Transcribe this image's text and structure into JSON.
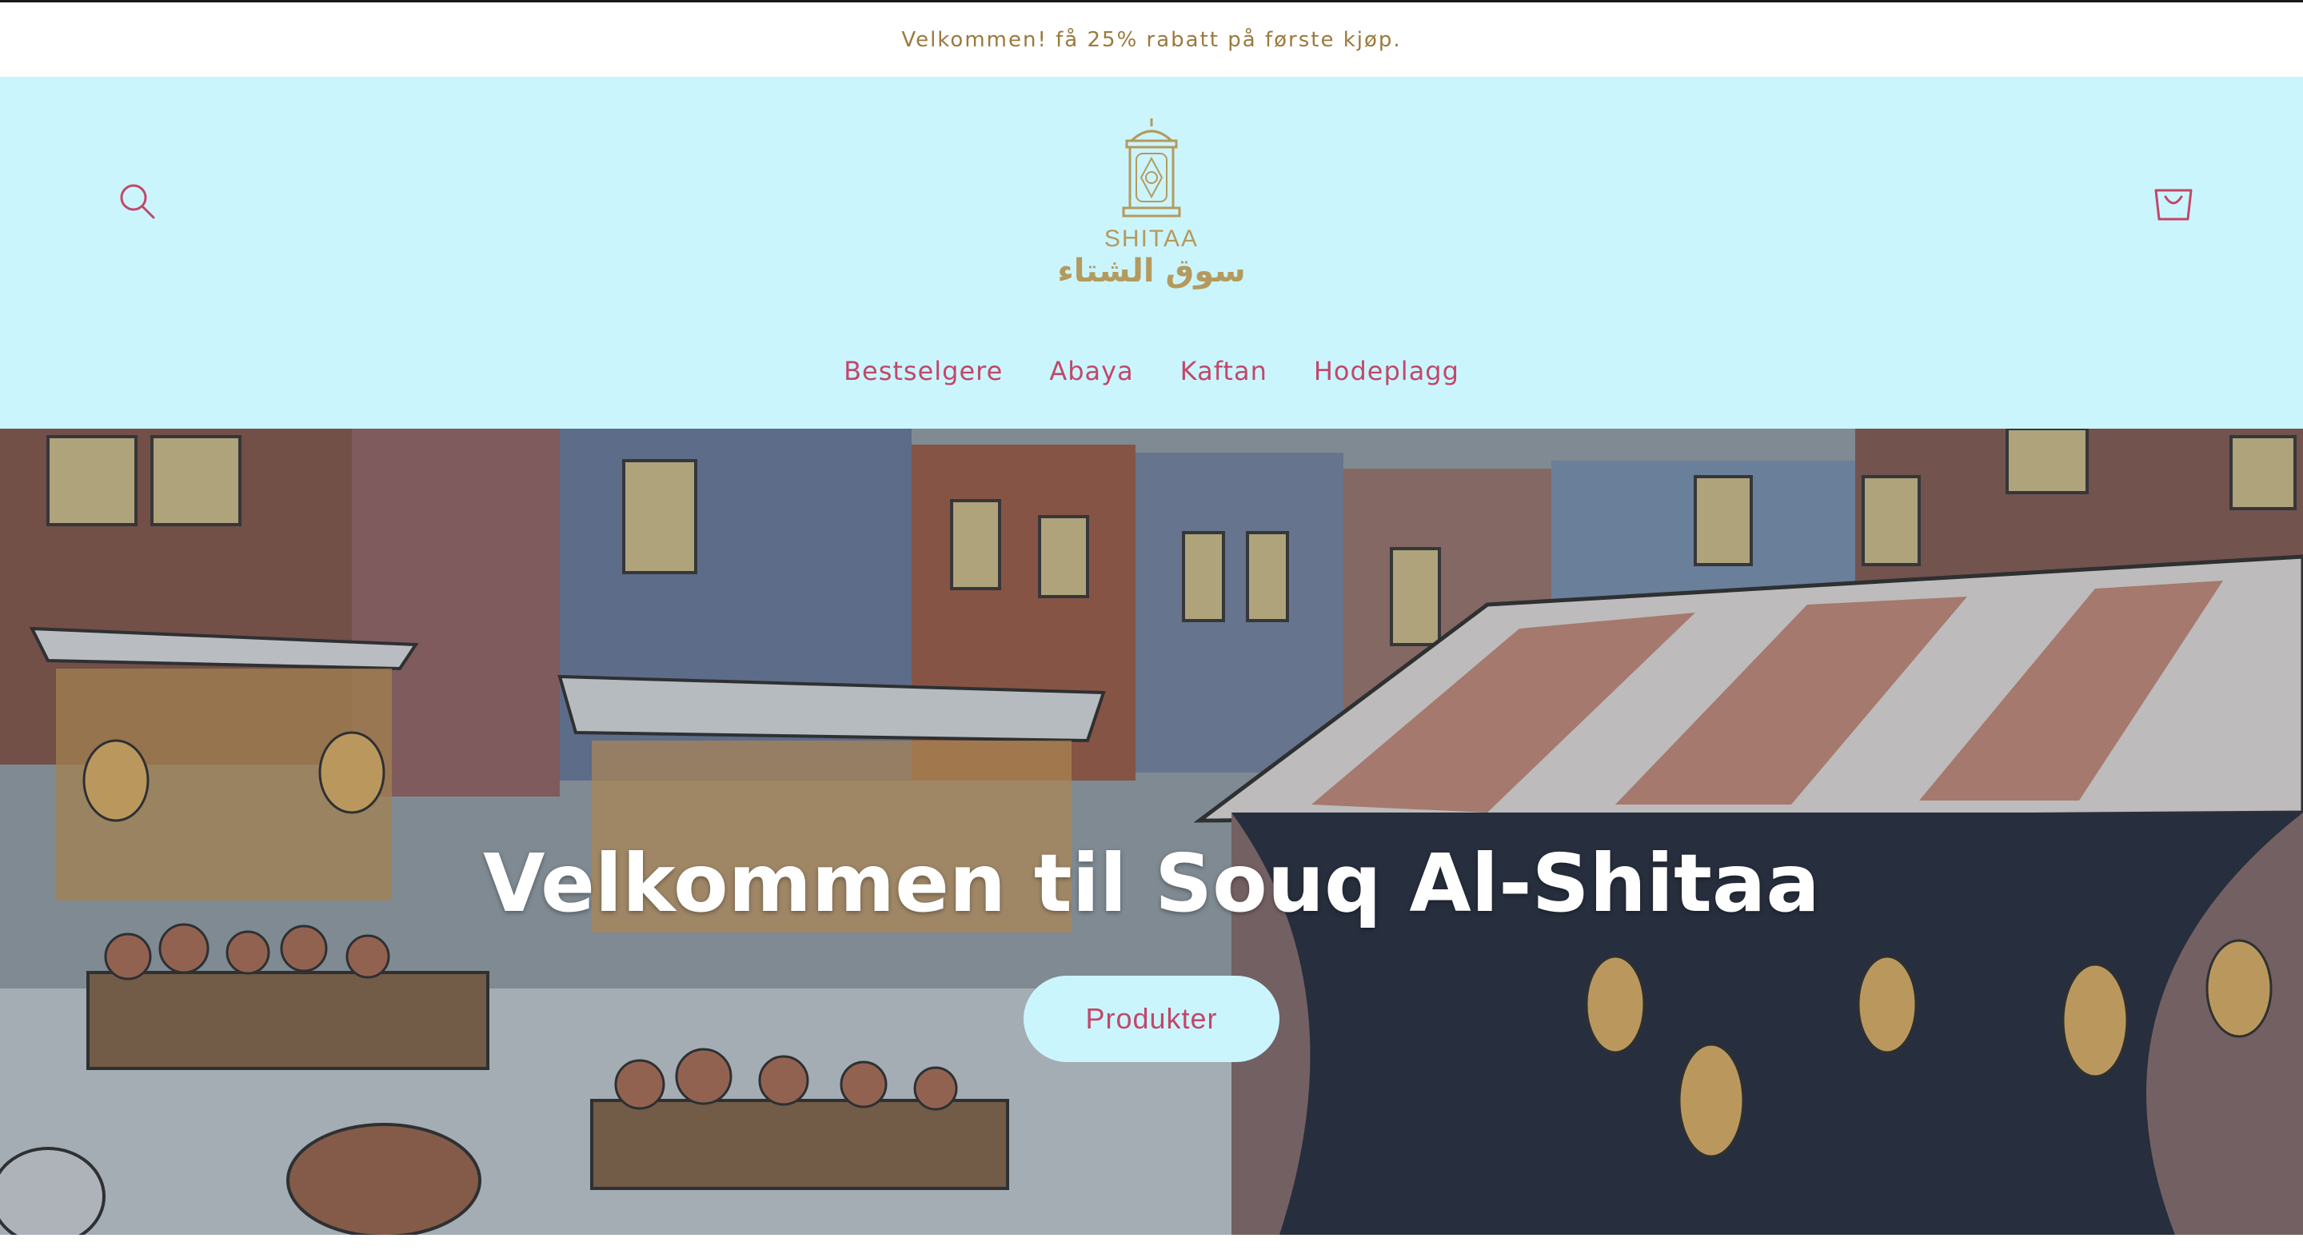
{
  "announcement": {
    "text": "Velkommen! få 25% rabatt på første kjøp."
  },
  "header": {
    "logo_latin": "SHITAA",
    "logo_arabic": "سوق الشتاء",
    "search_icon": "search-icon",
    "cart_icon": "cart-icon"
  },
  "nav": {
    "items": [
      {
        "label": "Bestselgere"
      },
      {
        "label": "Abaya"
      },
      {
        "label": "Kaftan"
      },
      {
        "label": "Hodeplagg"
      }
    ]
  },
  "hero": {
    "title": "Velkommen til Souq Al-Shitaa",
    "button_label": "Produkter"
  },
  "colors": {
    "header_bg": "#cbf5fc",
    "accent": "#c1486a",
    "gold": "#b49a5e",
    "announcement_text": "#9a7a3c"
  }
}
